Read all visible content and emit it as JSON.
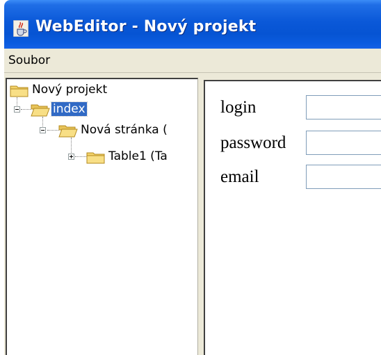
{
  "window": {
    "title": "WebEditor - Nový projekt",
    "app_icon": "java-cup-icon",
    "titlebar_color": "#0654d3"
  },
  "menubar": {
    "items": [
      {
        "label": "Soubor"
      }
    ]
  },
  "tree": {
    "root": {
      "label": "Nový projekt",
      "icon": "folder-icon"
    },
    "nodes": [
      {
        "label": "index",
        "icon": "folder-open-icon",
        "selected": true,
        "expander": "minus"
      },
      {
        "label": "Nová stránka (",
        "icon": "folder-open-icon",
        "expander": "minus"
      },
      {
        "label": "Table1 (Ta",
        "icon": "folder-icon",
        "expander": "plus"
      }
    ],
    "selection_color": "#316ac5"
  },
  "form": {
    "fields": [
      {
        "label": "login",
        "value": ""
      },
      {
        "label": "password",
        "value": ""
      },
      {
        "label": "email",
        "value": ""
      }
    ]
  }
}
